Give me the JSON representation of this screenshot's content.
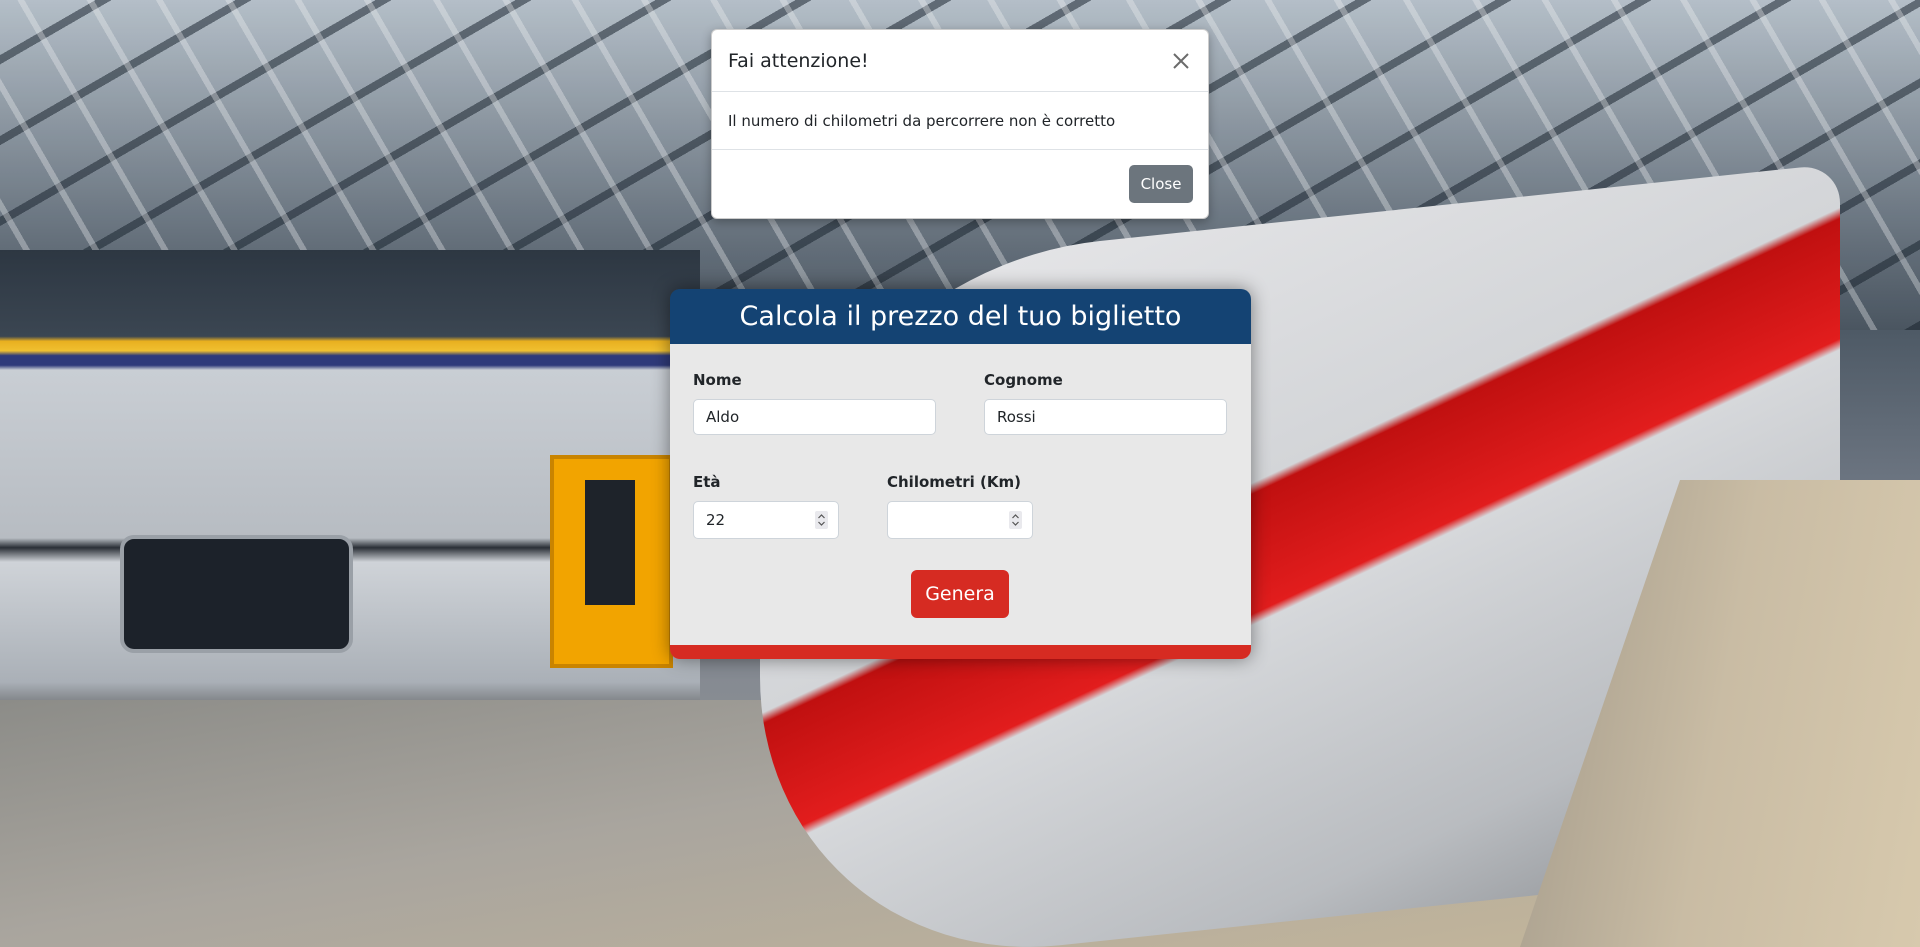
{
  "modal": {
    "title": "Fai attenzione!",
    "message": "Il numero di chilometri da percorrere non è corretto",
    "close_label": "Close"
  },
  "form": {
    "title": "Calcola il prezzo del tuo biglietto",
    "nome": {
      "label": "Nome",
      "value": "Aldo"
    },
    "cognome": {
      "label": "Cognome",
      "value": "Rossi"
    },
    "eta": {
      "label": "Età",
      "value": "22"
    },
    "km": {
      "label": "Chilometri (Km)",
      "value": ""
    },
    "submit_label": "Genera"
  },
  "colors": {
    "header": "#144373",
    "accent": "#d62b22",
    "secondary": "#6c757d",
    "card_body": "#e8e8e8"
  },
  "icons": {
    "modal_close": "close-icon",
    "spinner": "spinner-arrows-icon"
  }
}
